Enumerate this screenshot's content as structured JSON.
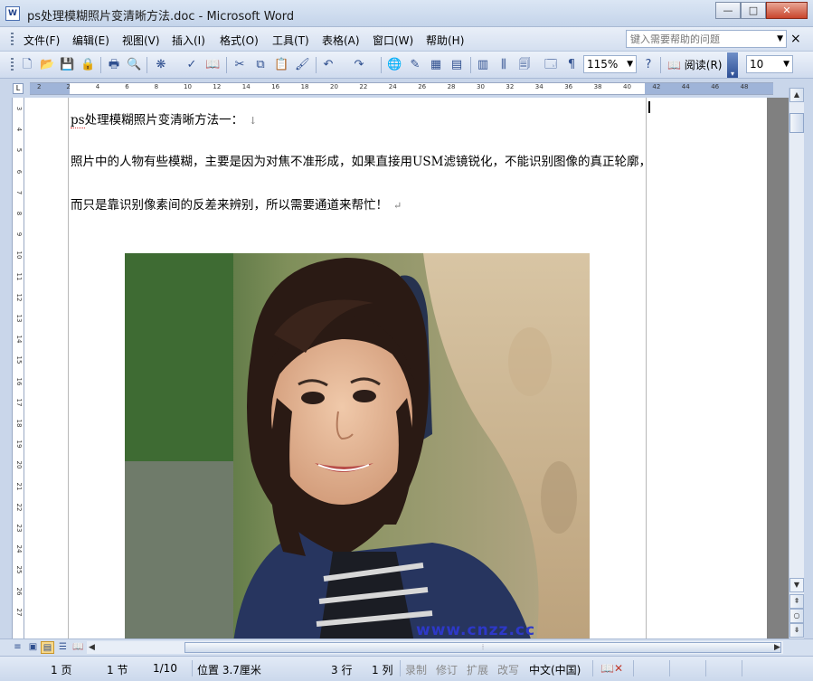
{
  "window": {
    "title": "ps处理模糊照片变清晰方法.doc - Microsoft Word",
    "app_icon": "W",
    "minimize": "—",
    "maximize": "□",
    "close": "✕"
  },
  "menubar": {
    "items": [
      "文件(F)",
      "编辑(E)",
      "视图(V)",
      "插入(I)",
      "格式(O)",
      "工具(T)",
      "表格(A)",
      "窗口(W)",
      "帮助(H)"
    ],
    "help_placeholder": "键入需要帮助的问题",
    "close_doc": "×"
  },
  "toolbar": {
    "zoom": "115%",
    "read_label": "阅读(R)",
    "font_size": "10"
  },
  "ruler": {
    "h_labels": [
      "2",
      "2",
      "4",
      "6",
      "8",
      "10",
      "12",
      "14",
      "16",
      "18",
      "20",
      "22",
      "24",
      "26",
      "28",
      "30",
      "32",
      "34",
      "36",
      "38",
      "40",
      "42",
      "44",
      "46",
      "48"
    ],
    "v_labels": [
      "3",
      "4",
      "5",
      "6",
      "7",
      "8",
      "9",
      "10",
      "11",
      "12",
      "13",
      "14",
      "15",
      "16",
      "17",
      "18",
      "19",
      "20",
      "21",
      "22",
      "23",
      "24",
      "25",
      "26",
      "27"
    ]
  },
  "document": {
    "line1_prefix": "ps",
    "line1_rest": "处理模糊照片变清晰方法一：",
    "line1_mark": "↓",
    "line2": "照片中的人物有些模糊，主要是因为对焦不准形成，如果直接用USM滤镜锐化，不能识别图像的真正轮廓，",
    "line3": "而只是靠识别像素间的反差来辨别，所以需要通道来帮忙！",
    "line3_mark": "↵",
    "watermark": "www.cnzz.cc"
  },
  "statusbar": {
    "page": "1 页",
    "section": "1 节",
    "page_of": "1/10",
    "position": "位置 3.7厘米",
    "line": "3 行",
    "column": "1 列",
    "rec": "录制",
    "trk": "修订",
    "ext": "扩展",
    "ovr": "改写",
    "language": "中文(中国)"
  }
}
